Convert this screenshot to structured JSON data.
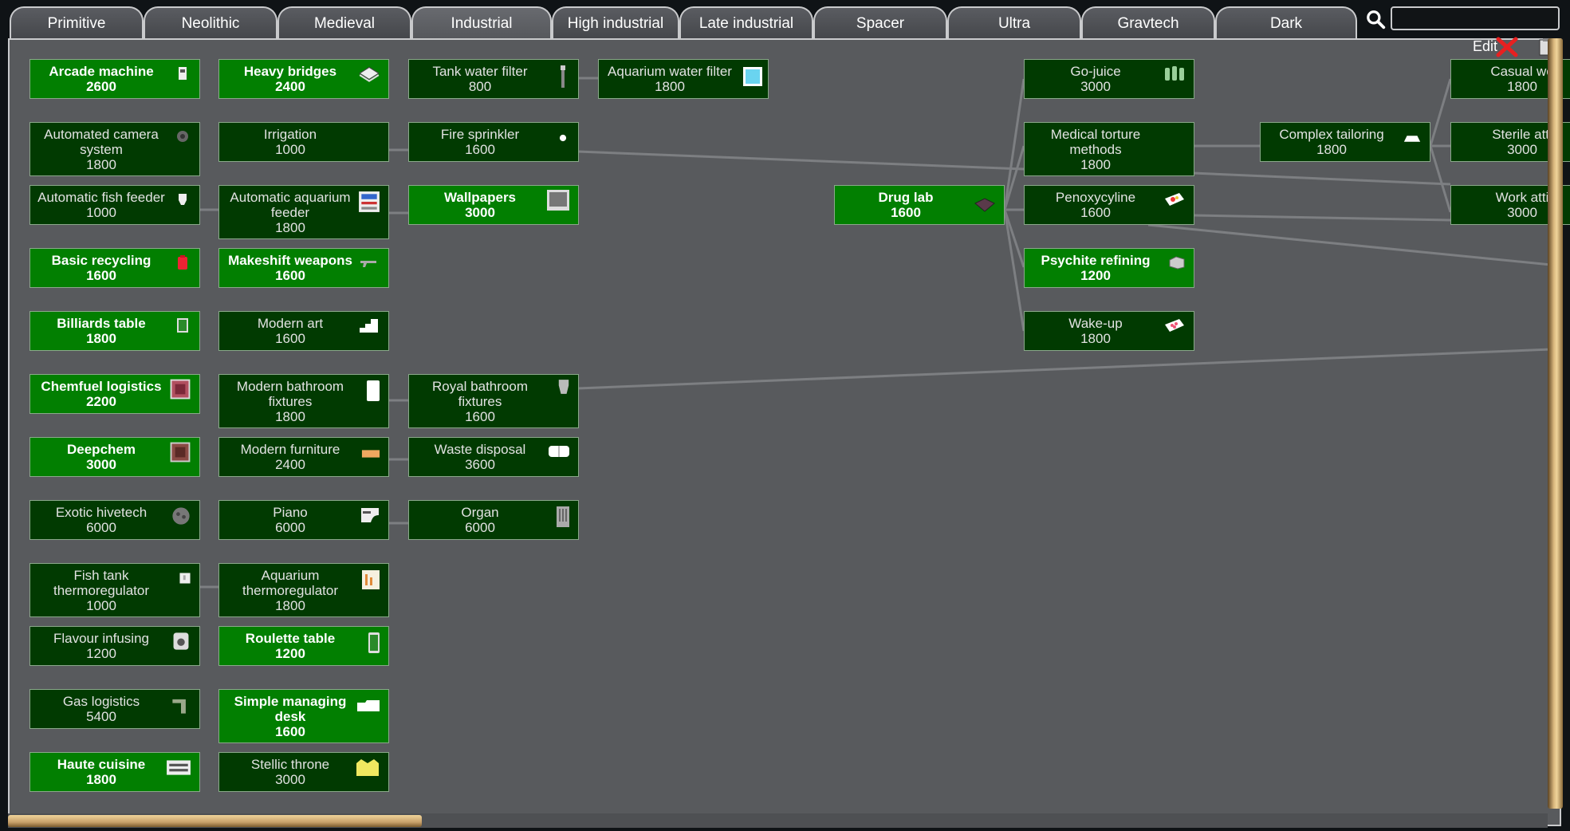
{
  "tabs": [
    {
      "label": "Primitive",
      "active": false
    },
    {
      "label": "Neolithic",
      "active": false
    },
    {
      "label": "Medieval",
      "active": false
    },
    {
      "label": "Industrial",
      "active": true
    },
    {
      "label": "High industrial",
      "active": false
    },
    {
      "label": "Late industrial",
      "active": false
    },
    {
      "label": "Spacer",
      "active": false
    },
    {
      "label": "Ultra",
      "active": false
    },
    {
      "label": "Gravtech",
      "active": false
    },
    {
      "label": "Dark",
      "active": false
    }
  ],
  "search": {
    "value": "",
    "placeholder": ""
  },
  "toolbar": {
    "edit_label": "Edit"
  },
  "colors": {
    "researched": "#027f01",
    "unresearched": "#013a01",
    "canvas": "#585a5d",
    "scrollbar": "#d8b67c"
  },
  "nodes": {
    "arcade_machine": {
      "title": "Arcade machine",
      "cost": "2600",
      "researched": true,
      "icon": "arcade-icon"
    },
    "heavy_bridges": {
      "title": "Heavy bridges",
      "cost": "2400",
      "researched": true,
      "icon": "bridge-icon"
    },
    "tank_water_filter": {
      "title": "Tank water filter",
      "cost": "800",
      "researched": false,
      "icon": "filter-icon"
    },
    "aquarium_water_filter": {
      "title": "Aquarium water filter",
      "cost": "1800",
      "researched": false,
      "icon": "aquarium-icon"
    },
    "go_juice": {
      "title": "Go-juice",
      "cost": "3000",
      "researched": false,
      "icon": "go-juice-icon"
    },
    "casual_wear": {
      "title": "Casual we",
      "cost": "1800",
      "researched": false,
      "icon": "apparel-icon"
    },
    "automated_camera": {
      "title": "Automated camera system",
      "cost": "1800",
      "researched": false,
      "icon": "camera-icon"
    },
    "irrigation": {
      "title": "Irrigation",
      "cost": "1000",
      "researched": false,
      "icon": ""
    },
    "fire_sprinkler": {
      "title": "Fire sprinkler",
      "cost": "1600",
      "researched": false,
      "icon": "sprinkler-icon"
    },
    "medical_torture": {
      "title": "Medical torture methods",
      "cost": "1800",
      "researched": false,
      "icon": ""
    },
    "complex_tailoring": {
      "title": "Complex tailoring",
      "cost": "1800",
      "researched": false,
      "icon": "hat-icon"
    },
    "sterile_attire": {
      "title": "Sterile atti",
      "cost": "3000",
      "researched": false,
      "icon": ""
    },
    "automatic_fish_feeder": {
      "title": "Automatic fish feeder",
      "cost": "1000",
      "researched": false,
      "icon": "feeder-icon"
    },
    "automatic_aquarium_feeder": {
      "title": "Automatic aquarium feeder",
      "cost": "1800",
      "researched": false,
      "icon": "aquarium-feeder-icon"
    },
    "wallpapers": {
      "title": "Wallpapers",
      "cost": "3000",
      "researched": true,
      "icon": "wallpaper-icon"
    },
    "drug_lab": {
      "title": "Drug lab",
      "cost": "1600",
      "researched": true,
      "icon": "drug-lab-icon"
    },
    "penoxycyline": {
      "title": "Penoxycyline",
      "cost": "1600",
      "researched": false,
      "icon": "pill-icon"
    },
    "work_attire": {
      "title": "Work atti",
      "cost": "3000",
      "researched": false,
      "icon": ""
    },
    "basic_recycling": {
      "title": "Basic recycling",
      "cost": "1600",
      "researched": true,
      "icon": "recycle-can-icon"
    },
    "makeshift_weapons": {
      "title": "Makeshift weapons",
      "cost": "1600",
      "researched": true,
      "icon": "gun-icon"
    },
    "psychite_refining": {
      "title": "Psychite refining",
      "cost": "1200",
      "researched": true,
      "icon": "psychite-icon"
    },
    "billiards_table": {
      "title": "Billiards table",
      "cost": "1800",
      "researched": true,
      "icon": "billiards-icon"
    },
    "modern_art": {
      "title": "Modern art",
      "cost": "1600",
      "researched": false,
      "icon": "stairs-icon"
    },
    "wake_up": {
      "title": "Wake-up",
      "cost": "1800",
      "researched": false,
      "icon": "pill-pack-icon"
    },
    "chemfuel_logistics": {
      "title": "Chemfuel logistics",
      "cost": "2200",
      "researched": true,
      "icon": "chemfuel-icon"
    },
    "modern_bathroom": {
      "title": "Modern bathroom fixtures",
      "cost": "1800",
      "researched": false,
      "icon": "bathroom-icon"
    },
    "royal_bathroom": {
      "title": "Royal bathroom fixtures",
      "cost": "1600",
      "researched": false,
      "icon": "royal-toilet-icon"
    },
    "deepchem": {
      "title": "Deepchem",
      "cost": "3000",
      "researched": true,
      "icon": "deepchem-icon"
    },
    "modern_furniture": {
      "title": "Modern furniture",
      "cost": "2400",
      "researched": false,
      "icon": "furniture-icon"
    },
    "waste_disposal": {
      "title": "Waste disposal",
      "cost": "3600",
      "researched": false,
      "icon": "waste-icon"
    },
    "exotic_hivetech": {
      "title": "Exotic hivetech",
      "cost": "6000",
      "researched": false,
      "icon": "hive-icon"
    },
    "piano": {
      "title": "Piano",
      "cost": "6000",
      "researched": false,
      "icon": "piano-icon"
    },
    "organ": {
      "title": "Organ",
      "cost": "6000",
      "researched": false,
      "icon": "organ-icon"
    },
    "fish_tank_thermo": {
      "title": "Fish tank thermoregulator",
      "cost": "1000",
      "researched": false,
      "icon": "thermo-small-icon"
    },
    "aquarium_thermo": {
      "title": "Aquarium thermoregulator",
      "cost": "1800",
      "researched": false,
      "icon": "thermo-icon"
    },
    "flavour_infusing": {
      "title": "Flavour infusing",
      "cost": "1200",
      "researched": false,
      "icon": "infuser-icon"
    },
    "roulette_table": {
      "title": "Roulette table",
      "cost": "1200",
      "researched": true,
      "icon": "roulette-icon"
    },
    "gas_logistics": {
      "title": "Gas logistics",
      "cost": "5400",
      "researched": false,
      "icon": "pipe-icon"
    },
    "simple_managing_desk": {
      "title": "Simple managing desk",
      "cost": "1600",
      "researched": true,
      "icon": "desk-icon"
    },
    "haute_cuisine": {
      "title": "Haute cuisine",
      "cost": "1800",
      "researched": true,
      "icon": "stove-icon"
    },
    "stellic_throne": {
      "title": "Stellic throne",
      "cost": "3000",
      "researched": false,
      "icon": "throne-icon"
    }
  }
}
